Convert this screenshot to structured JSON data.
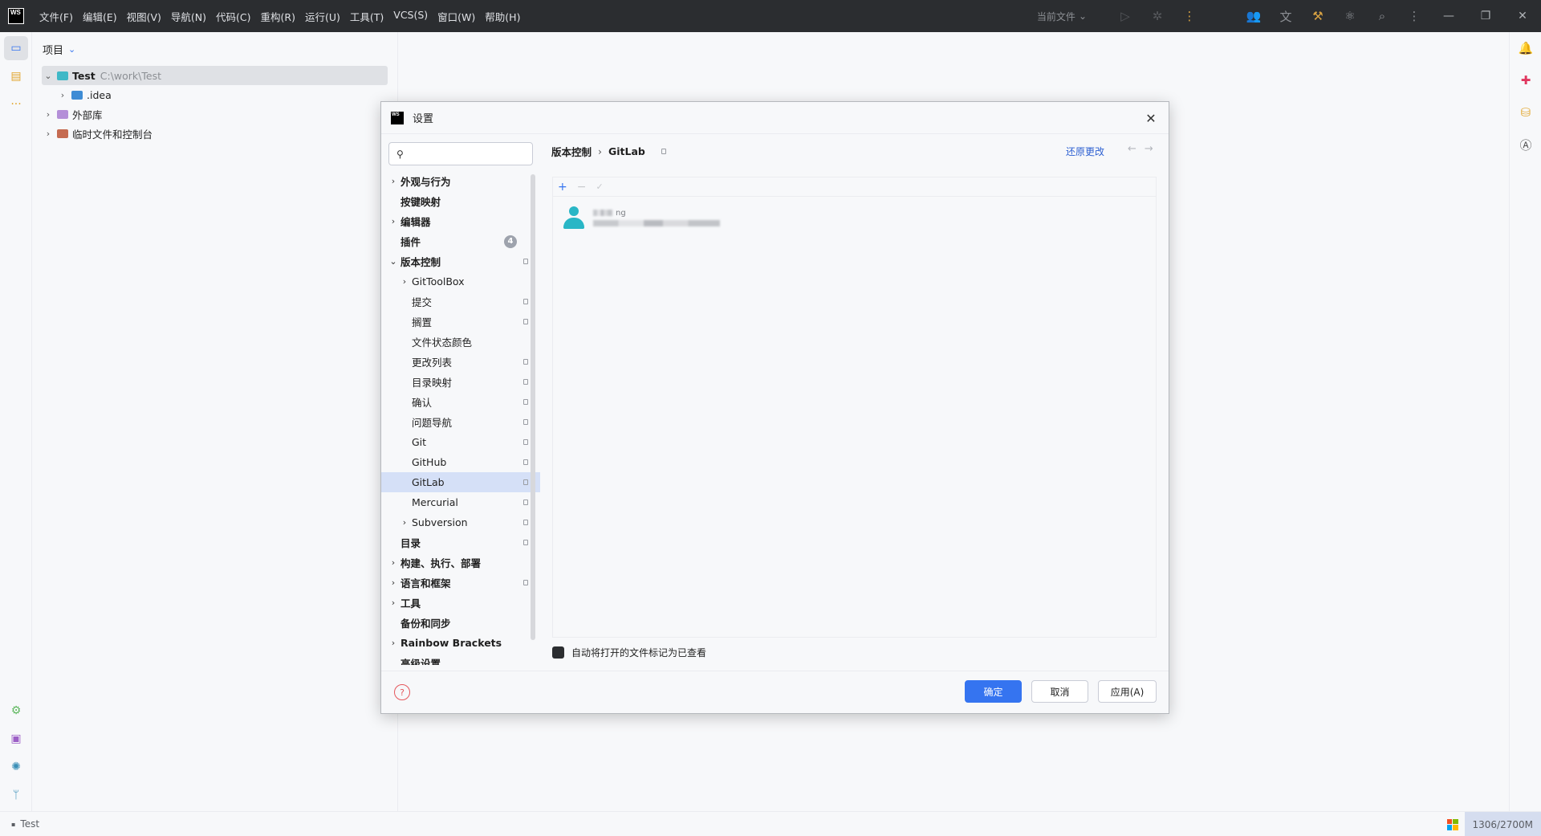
{
  "titlebar": {
    "logo_text": "WS",
    "menu": [
      "文件(F)",
      "编辑(E)",
      "视图(V)",
      "导航(N)",
      "代码(C)",
      "重构(R)",
      "运行(U)",
      "工具(T)",
      "VCS(S)",
      "窗口(W)",
      "帮助(H)"
    ],
    "run_config": "当前文件",
    "icons": [
      "run-icon",
      "debug-icon",
      "more-icon",
      "code-with-me-icon",
      "translate-icon",
      "build-tools-icon",
      "ai-assistant-icon",
      "search-icon",
      "settings-icon"
    ],
    "window_controls": [
      "minimize-icon",
      "restore-icon",
      "close-icon"
    ]
  },
  "project_panel": {
    "title": "项目",
    "root": {
      "name": "Test",
      "path": "C:\\work\\Test"
    },
    "children": [
      {
        "name": ".idea",
        "icon_color": "#3e8cd5"
      },
      {
        "name": "外部库",
        "icon_color": "#b48fd8"
      },
      {
        "name": "临时文件和控制台",
        "icon_color": "#c56b51"
      }
    ]
  },
  "dialog": {
    "title": "设置",
    "search_value": "",
    "nav": [
      {
        "label": "外观与行为",
        "level": 0,
        "bold": true,
        "chevron": "right"
      },
      {
        "label": "按键映射",
        "level": 0,
        "bold": true,
        "chevron": ""
      },
      {
        "label": "编辑器",
        "level": 0,
        "bold": true,
        "chevron": "right"
      },
      {
        "label": "插件",
        "level": 0,
        "bold": true,
        "chevron": "",
        "badge": "4"
      },
      {
        "label": "版本控制",
        "level": 0,
        "bold": true,
        "chevron": "down",
        "mark": true
      },
      {
        "label": "GitToolBox",
        "level": 1,
        "bold": false,
        "chevron": "right"
      },
      {
        "label": "提交",
        "level": 1,
        "bold": false,
        "chevron": "",
        "mark": true
      },
      {
        "label": "搁置",
        "level": 1,
        "bold": false,
        "chevron": "",
        "mark": true
      },
      {
        "label": "文件状态颜色",
        "level": 1,
        "bold": false,
        "chevron": ""
      },
      {
        "label": "更改列表",
        "level": 1,
        "bold": false,
        "chevron": "",
        "mark": true
      },
      {
        "label": "目录映射",
        "level": 1,
        "bold": false,
        "chevron": "",
        "mark": true
      },
      {
        "label": "确认",
        "level": 1,
        "bold": false,
        "chevron": "",
        "mark": true
      },
      {
        "label": "问题导航",
        "level": 1,
        "bold": false,
        "chevron": "",
        "mark": true
      },
      {
        "label": "Git",
        "level": 1,
        "bold": false,
        "chevron": "",
        "mark": true
      },
      {
        "label": "GitHub",
        "level": 1,
        "bold": false,
        "chevron": "",
        "mark": true
      },
      {
        "label": "GitLab",
        "level": 1,
        "bold": false,
        "chevron": "",
        "mark": true,
        "selected": true
      },
      {
        "label": "Mercurial",
        "level": 1,
        "bold": false,
        "chevron": "",
        "mark": true
      },
      {
        "label": "Subversion",
        "level": 1,
        "bold": false,
        "chevron": "right",
        "mark": true
      },
      {
        "label": "目录",
        "level": 0,
        "bold": true,
        "chevron": "",
        "mark": true
      },
      {
        "label": "构建、执行、部署",
        "level": 0,
        "bold": true,
        "chevron": "right"
      },
      {
        "label": "语言和框架",
        "level": 0,
        "bold": true,
        "chevron": "right",
        "mark": true
      },
      {
        "label": "工具",
        "level": 0,
        "bold": true,
        "chevron": "right"
      },
      {
        "label": "备份和同步",
        "level": 0,
        "bold": true,
        "chevron": ""
      },
      {
        "label": "Rainbow Brackets",
        "level": 0,
        "bold": true,
        "chevron": "right"
      },
      {
        "label": "高级设置",
        "level": 0,
        "bold": true,
        "chevron": ""
      }
    ],
    "breadcrumb": {
      "parent": "版本控制",
      "current": "GitLab"
    },
    "reset_link": "还原更改",
    "accounts": {
      "toolbar": {
        "add": "+",
        "remove": "−",
        "set_default": "✓"
      },
      "account": {
        "name_suffix": "ng"
      }
    },
    "auto_mark_label": "自动将打开的文件标记为已查看",
    "auto_mark_checked": true,
    "buttons": {
      "ok": "确定",
      "cancel": "取消",
      "apply": "应用(A)"
    },
    "help": "?"
  },
  "statusbar": {
    "project": "Test",
    "memory": "1306/2700M"
  },
  "colors": {
    "accent": "#3574f0",
    "titlebar_bg": "#2b2d30",
    "selection": "#d5e0f7",
    "avatar": "#29b6c6"
  }
}
